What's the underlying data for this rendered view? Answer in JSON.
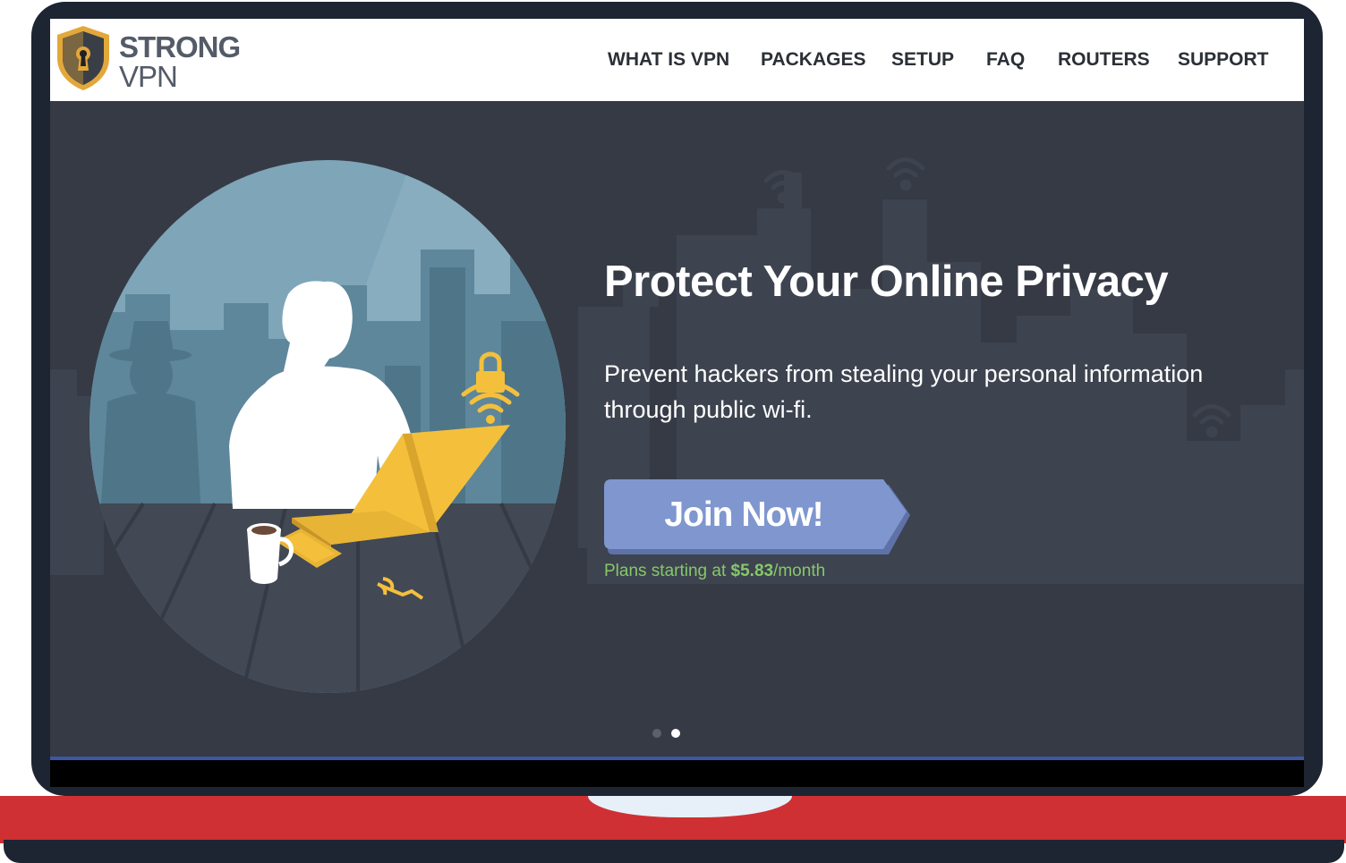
{
  "brand": {
    "line1": "STRONG",
    "line2": "VPN"
  },
  "nav": [
    {
      "label": "WHAT IS VPN"
    },
    {
      "label": "PACKAGES"
    },
    {
      "label": "SETUP"
    },
    {
      "label": "FAQ"
    },
    {
      "label": "ROUTERS"
    },
    {
      "label": "SUPPORT"
    }
  ],
  "hero": {
    "title": "Protect Your Online Privacy",
    "subtitle": "Prevent hackers from stealing your personal information through public wi-fi.",
    "cta_label": "Join Now!",
    "plans_prefix": "Plans starting at ",
    "plans_price": "$5.83",
    "plans_suffix": "/month"
  },
  "carousel": {
    "slide_count": 2,
    "active_slide": 2
  },
  "icons": [
    "shield-keyhole-icon",
    "wifi-icon",
    "padlock-wifi-icon",
    "key-icon",
    "coffee-mug-icon"
  ],
  "colors": {
    "hero_bg": "#353a45",
    "cta": "#7f96cf",
    "plans_text": "#86c86a",
    "laptop_frame": "#1c2531",
    "laptop_base": "#cf3033",
    "accent_gold": "#f4c03c"
  }
}
